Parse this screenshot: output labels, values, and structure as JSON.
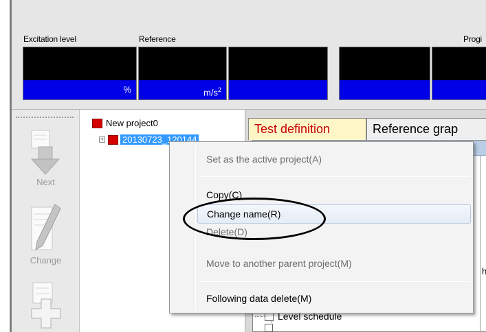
{
  "meters": {
    "excitation_label": "Excitation level",
    "reference_label": "Reference",
    "progress_label": "Progi",
    "excitation_unit": "%",
    "reference_unit": "m/s",
    "reference_unit_exponent": "2"
  },
  "toolbar": {
    "next_label": "Next",
    "change_label": "Change"
  },
  "tree": {
    "root_label": "New project0",
    "child_label": "20130723_120144",
    "expander_symbol": "+"
  },
  "tabs": [
    {
      "label": "Test definition"
    },
    {
      "label": "Reference grap"
    }
  ],
  "content": {
    "stub_letter": "h",
    "level_schedule_label": "Level schedule"
  },
  "context_menu": {
    "items": [
      {
        "label": "Set as the active project(A)",
        "enabled": false
      },
      {
        "label": "Copy(C)",
        "enabled": true
      },
      {
        "label": "Change name(R)",
        "enabled": true,
        "highlighted": true
      },
      {
        "label": "Delete(D)",
        "enabled": false
      },
      {
        "label": "Move to another parent project(M)",
        "enabled": false
      },
      {
        "label": "Following data delete(M)",
        "enabled": true
      }
    ]
  },
  "colors": {
    "meter_unit_bar": "#0000e6",
    "active_tab_text": "#c70000",
    "project_icon": "#d40000",
    "selection": "#3399ff"
  }
}
